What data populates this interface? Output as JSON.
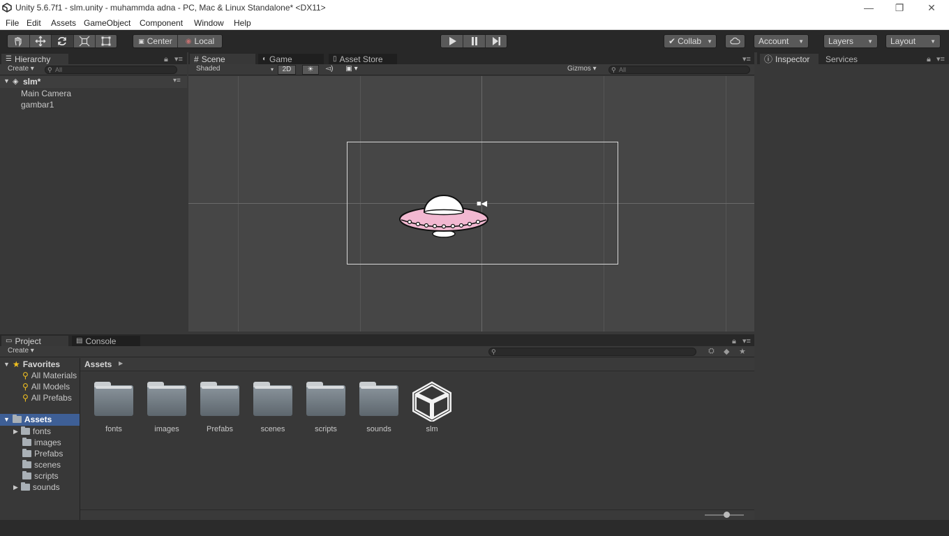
{
  "window": {
    "title": "Unity 5.6.7f1 - slm.unity - muhammda adna - PC, Mac & Linux Standalone* <DX11>",
    "minimize": "—",
    "restore": "❐",
    "close": "✕"
  },
  "menu": [
    "File",
    "Edit",
    "Assets",
    "GameObject",
    "Component",
    "Window",
    "Help"
  ],
  "toolbar": {
    "pivot": "Center",
    "space": "Local",
    "collab": "Collab",
    "account": "Account",
    "layers": "Layers",
    "layout": "Layout"
  },
  "hierarchy": {
    "tab": "Hierarchy",
    "create": "Create",
    "search_placeholder": "All",
    "scene_name": "slm*",
    "items": [
      "Main Camera",
      "gambar1"
    ]
  },
  "scene": {
    "tabs": [
      "Scene",
      "Game",
      "Asset Store"
    ],
    "shading": "Shaded",
    "mode_2d": "2D",
    "gizmos": "Gizmos",
    "search_placeholder": "All"
  },
  "inspector": {
    "tabs": [
      "Inspector",
      "Services"
    ]
  },
  "project": {
    "tabs": [
      "Project",
      "Console"
    ],
    "create": "Create",
    "favorites": {
      "label": "Favorites",
      "items": [
        "All Materials",
        "All Models",
        "All Prefabs"
      ]
    },
    "assets_root": "Assets",
    "tree": [
      "fonts",
      "images",
      "Prefabs",
      "scenes",
      "scripts",
      "sounds"
    ],
    "breadcrumb": "Assets",
    "grid_items": [
      "fonts",
      "images",
      "Prefabs",
      "scenes",
      "scripts",
      "sounds",
      "slm"
    ]
  },
  "colors": {
    "accent_selected": "#3e5f96",
    "ufo_pink": "#f2b8d1",
    "background": "#383838"
  }
}
